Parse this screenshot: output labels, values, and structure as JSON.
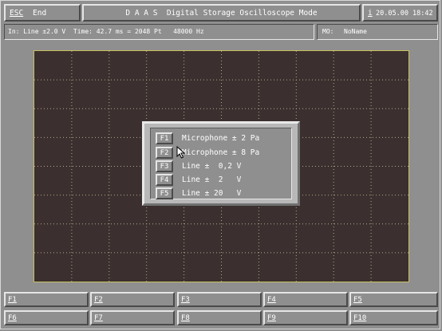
{
  "topbar": {
    "esc_key": "ESC",
    "esc_label": "End",
    "title": "D A A S  Digital Storage Oscilloscope Mode",
    "date_icon": "i",
    "datetime": "20.05.00 18:42"
  },
  "info": {
    "input_text": "In: Line ±2.0 V  Time: 42.7 ms = 2048 Pt   48000 Hz",
    "mo_label": "MO:",
    "mo_value": "NoName"
  },
  "popup": {
    "options": [
      {
        "key": "F1",
        "label": "Microphone ± 2 Pa"
      },
      {
        "key": "F2",
        "label": "Microphone ± 8 Pa"
      },
      {
        "key": "F3",
        "label": "Line ±  0,2 V"
      },
      {
        "key": "F4",
        "label": "Line ±  2   V"
      },
      {
        "key": "F5",
        "label": "Line ± 20   V"
      }
    ]
  },
  "fkeys": [
    "F1",
    "F2",
    "F3",
    "F4",
    "F5",
    "F6",
    "F7",
    "F8",
    "F9",
    "F10"
  ],
  "colors": {
    "background": "#8f8f8f",
    "scope_bg": "#3b2f2f",
    "grid_dots": "#b8a888",
    "scope_border": "#c8c060"
  },
  "icons": {
    "cursor": "mouse-pointer-icon"
  }
}
